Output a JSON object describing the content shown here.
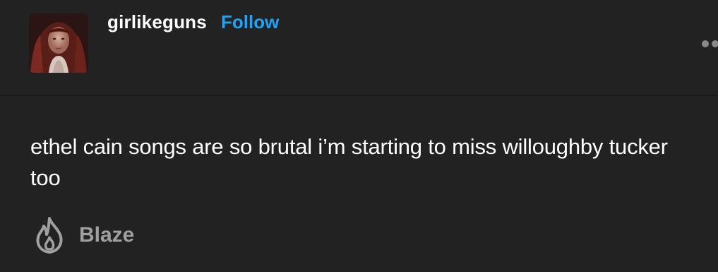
{
  "post": {
    "author": {
      "username": "girlikeguns",
      "follow_label": "Follow",
      "avatar": "avatar-photo"
    },
    "menu_icon": "more-dots-icon",
    "body_text": "ethel cain songs are so brutal i’m starting to miss willoughby tucker too",
    "actions": {
      "blaze_label": "Blaze",
      "blaze_icon": "flame-icon"
    }
  },
  "colors": {
    "background": "#222222",
    "accent": "#1fa2f3",
    "text": "#ffffff",
    "muted": "#a0a0a0"
  }
}
